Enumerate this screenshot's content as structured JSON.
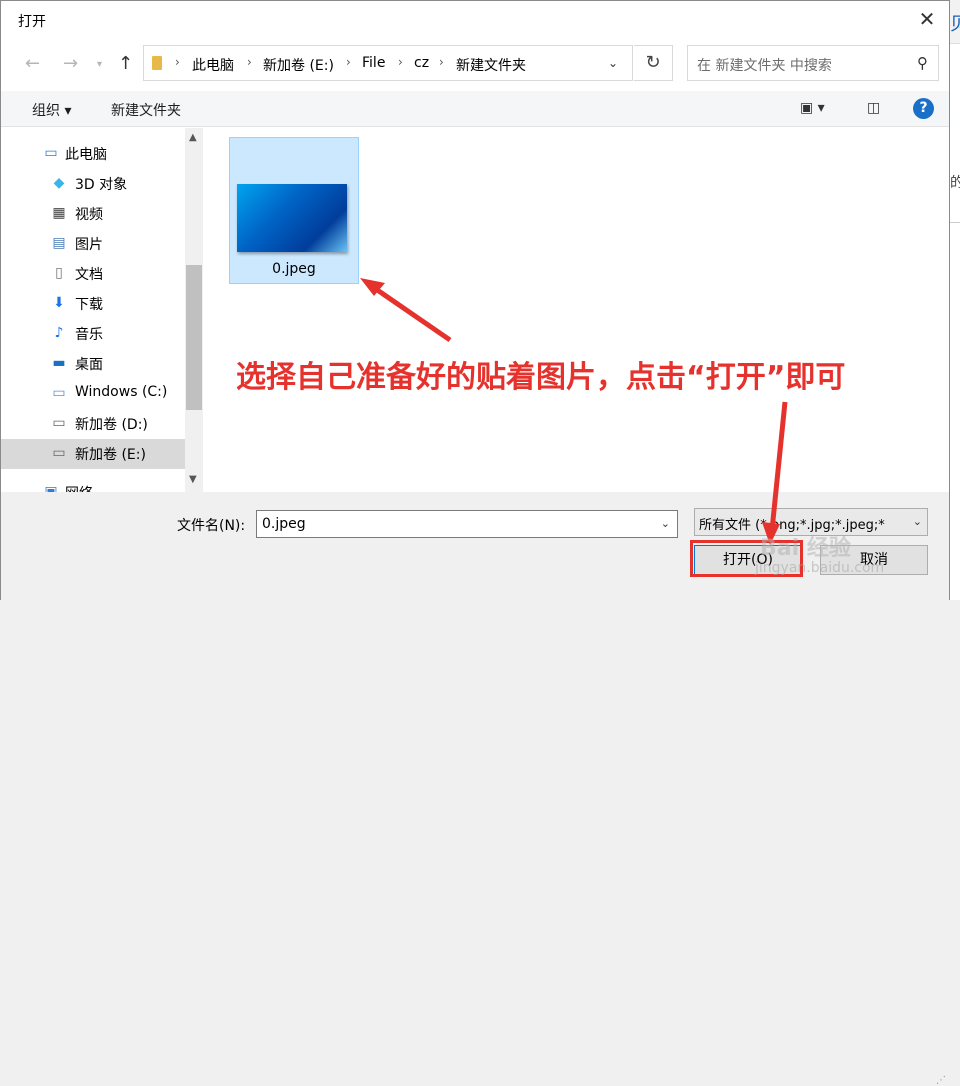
{
  "dialog": {
    "title": "打开",
    "close_label": "✕"
  },
  "address_bar": {
    "crumbs": [
      "此电脑",
      "新加卷 (E:)",
      "File",
      "cz",
      "新建文件夹"
    ],
    "search_placeholder": "在 新建文件夹 中搜索"
  },
  "toolbar": {
    "organize": "组织 ▾",
    "new_folder": "新建文件夹",
    "help": "?"
  },
  "sidebar": {
    "items": [
      {
        "label": "此电脑",
        "icon": "computer-icon"
      },
      {
        "label": "3D 对象",
        "icon": "3d-objects-icon"
      },
      {
        "label": "视频",
        "icon": "video-icon"
      },
      {
        "label": "图片",
        "icon": "pictures-icon"
      },
      {
        "label": "文档",
        "icon": "documents-icon"
      },
      {
        "label": "下载",
        "icon": "download-icon"
      },
      {
        "label": "音乐",
        "icon": "music-icon"
      },
      {
        "label": "桌面",
        "icon": "desktop-icon"
      },
      {
        "label": "Windows (C:)",
        "icon": "drive-icon"
      },
      {
        "label": "新加卷 (D:)",
        "icon": "drive-icon"
      },
      {
        "label": "新加卷 (E:)",
        "icon": "drive-icon",
        "selected": true
      },
      {
        "label": "网络",
        "icon": "network-icon"
      }
    ]
  },
  "files": [
    {
      "name": "0.jpeg",
      "selected": true
    }
  ],
  "annotation": {
    "text": "选择自己准备好的贴着图片，点击“打开”即可",
    "color": "#e5322d"
  },
  "footer": {
    "filename_label": "文件名(N):",
    "filename_value": "0.jpeg",
    "filetype_value": "所有文件 (*.png;*.jpg;*.jpeg;*",
    "open_button": "打开(O)",
    "cancel_button": "取消"
  },
  "watermark": {
    "line1": "Bai 经验",
    "line2": "jingyan.baidu.com"
  },
  "behind_window": {
    "glyph_top": "贝",
    "glyph_mid": "的"
  }
}
